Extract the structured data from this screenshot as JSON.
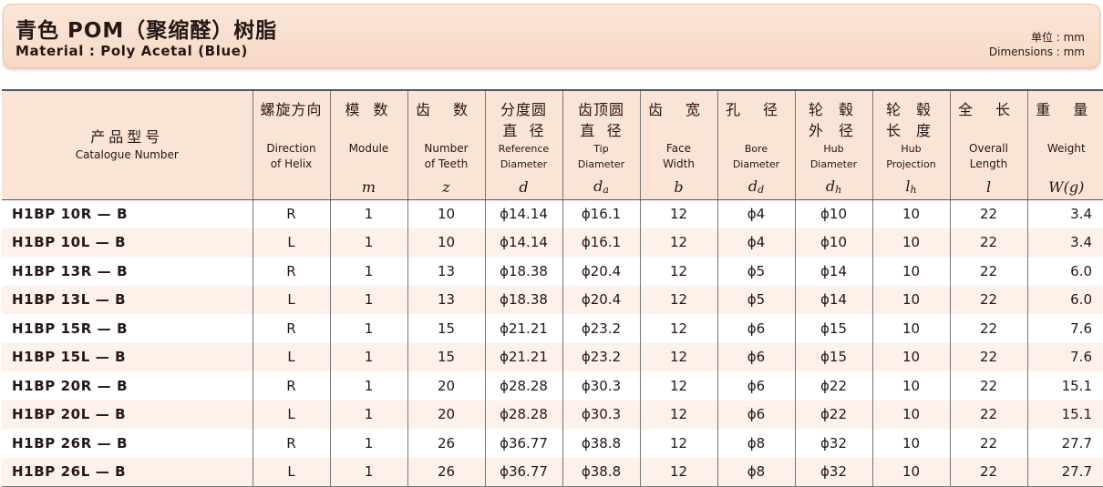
{
  "header": {
    "title": "青色 POM（聚缩醛）树脂",
    "subtitle": "Material : Poly Acetal (Blue)",
    "unit_cn": "单位 : mm",
    "unit_en": "Dimensions : mm"
  },
  "columns": [
    {
      "cn": "产品型号",
      "en": "Catalogue Number",
      "sym": ""
    },
    {
      "cn": "螺旋方向",
      "en": "Direction of Helix",
      "sym": ""
    },
    {
      "cn": "模 数",
      "en": "Module",
      "sym": "m"
    },
    {
      "cn": "齿 数",
      "en": "Number of Teeth",
      "sym": "z"
    },
    {
      "cn": "分度圆 直 径",
      "en": "Reference Diameter",
      "sym": "d"
    },
    {
      "cn": "齿顶圆 直 径",
      "en": "Tip Diameter",
      "sym": "da"
    },
    {
      "cn": "齿 宽",
      "en": "Face Width",
      "sym": "b"
    },
    {
      "cn": "孔 径",
      "en": "Bore Diameter",
      "sym": "dd"
    },
    {
      "cn": "轮 毂 外 径",
      "en": "Hub Diameter",
      "sym": "dh"
    },
    {
      "cn": "轮 毂 长 度",
      "en": "Hub Projection",
      "sym": "lh"
    },
    {
      "cn": "全 长",
      "en": "Overall Length",
      "sym": "l"
    },
    {
      "cn": "重 量",
      "en": "Weight",
      "sym": "W(g)"
    }
  ],
  "rows": [
    [
      "H1BP 10R — B",
      "R",
      "1",
      "10",
      "ϕ14.14",
      "ϕ16.1",
      "12",
      "ϕ4",
      "ϕ10",
      "10",
      "22",
      "3.4"
    ],
    [
      "H1BP 10L — B",
      "L",
      "1",
      "10",
      "ϕ14.14",
      "ϕ16.1",
      "12",
      "ϕ4",
      "ϕ10",
      "10",
      "22",
      "3.4"
    ],
    [
      "H1BP 13R — B",
      "R",
      "1",
      "13",
      "ϕ18.38",
      "ϕ20.4",
      "12",
      "ϕ5",
      "ϕ14",
      "10",
      "22",
      "6.0"
    ],
    [
      "H1BP 13L — B",
      "L",
      "1",
      "13",
      "ϕ18.38",
      "ϕ20.4",
      "12",
      "ϕ5",
      "ϕ14",
      "10",
      "22",
      "6.0"
    ],
    [
      "H1BP 15R — B",
      "R",
      "1",
      "15",
      "ϕ21.21",
      "ϕ23.2",
      "12",
      "ϕ6",
      "ϕ15",
      "10",
      "22",
      "7.6"
    ],
    [
      "H1BP 15L — B",
      "L",
      "1",
      "15",
      "ϕ21.21",
      "ϕ23.2",
      "12",
      "ϕ6",
      "ϕ15",
      "10",
      "22",
      "7.6"
    ],
    [
      "H1BP 20R — B",
      "R",
      "1",
      "20",
      "ϕ28.28",
      "ϕ30.3",
      "12",
      "ϕ6",
      "ϕ22",
      "10",
      "22",
      "15.1"
    ],
    [
      "H1BP 20L — B",
      "L",
      "1",
      "20",
      "ϕ28.28",
      "ϕ30.3",
      "12",
      "ϕ6",
      "ϕ22",
      "10",
      "22",
      "15.1"
    ],
    [
      "H1BP 26R — B",
      "R",
      "1",
      "26",
      "ϕ36.77",
      "ϕ38.8",
      "12",
      "ϕ8",
      "ϕ32",
      "10",
      "22",
      "27.7"
    ],
    [
      "H1BP 26L — B",
      "L",
      "1",
      "26",
      "ϕ36.77",
      "ϕ38.8",
      "12",
      "ϕ8",
      "ϕ32",
      "10",
      "22",
      "27.7"
    ]
  ]
}
